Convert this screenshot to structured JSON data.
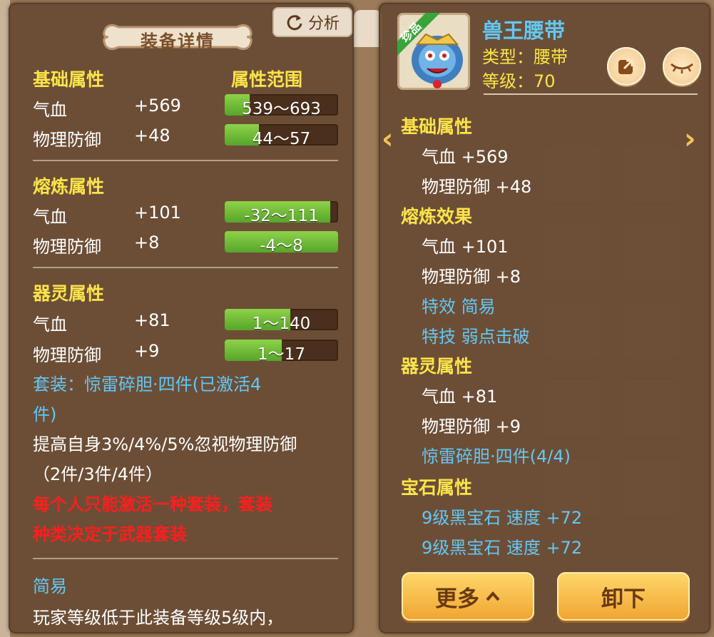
{
  "left_panel": {
    "title": "装备详情",
    "analyze_label": "分析",
    "basic": {
      "heading": "基础属性",
      "range_heading": "属性范围",
      "rows": [
        {
          "name": "气血",
          "value": "+569",
          "range": "539～693",
          "fill": 0.22
        },
        {
          "name": "物理防御",
          "value": "+48",
          "range": "44～57",
          "fill": 0.3
        }
      ]
    },
    "smelt": {
      "heading": "熔炼属性",
      "rows": [
        {
          "name": "气血",
          "value": "+101",
          "range": "-32～111",
          "fill": 0.93
        },
        {
          "name": "物理防御",
          "value": "+8",
          "range": "-4～8",
          "fill": 1.0
        }
      ]
    },
    "spirit": {
      "heading": "器灵属性",
      "rows": [
        {
          "name": "气血",
          "value": "+81",
          "range": "1～140",
          "fill": 0.58
        },
        {
          "name": "物理防御",
          "value": "+9",
          "range": "1～17",
          "fill": 0.5
        }
      ]
    },
    "suit_line1": "套装：惊雷碎胆·四件(已激活4",
    "suit_line2": "件)",
    "suit_desc_line1": "提高自身3%/4%/5%忽视物理防御",
    "suit_desc_line2": "（2件/3件/4件）",
    "warning_line1": "每个人只能激活一种套装，套装",
    "warning_line2": "种类决定于武器套装",
    "simple_title": "简易",
    "simple_desc": "玩家等级低于此装备等级5级内，"
  },
  "right_panel": {
    "badge": "珍品",
    "item_name": "兽王腰带",
    "item_type": "类型：腰带",
    "item_level": "等级：70",
    "share_icon": "share-icon",
    "eye_icon": "eye-closed-icon",
    "basic_heading": "基础属性",
    "basic_rows": [
      "气血 +569",
      "物理防御 +48"
    ],
    "smelt_heading": "熔炼效果",
    "smelt_rows": [
      "气血 +101",
      "物理防御 +8"
    ],
    "effect_rows": [
      "特效 简易",
      "特技 弱点击破"
    ],
    "spirit_heading": "器灵属性",
    "spirit_rows": [
      "气血 +81",
      "物理防御 +9"
    ],
    "suit_row": "惊雷碎胆·四件(4/4)",
    "gem_heading": "宝石属性",
    "gem_rows": [
      "9级黑宝石 速度 +72",
      "9级黑宝石 速度 +72"
    ],
    "more_label": "更多",
    "unequip_label": "卸下"
  }
}
